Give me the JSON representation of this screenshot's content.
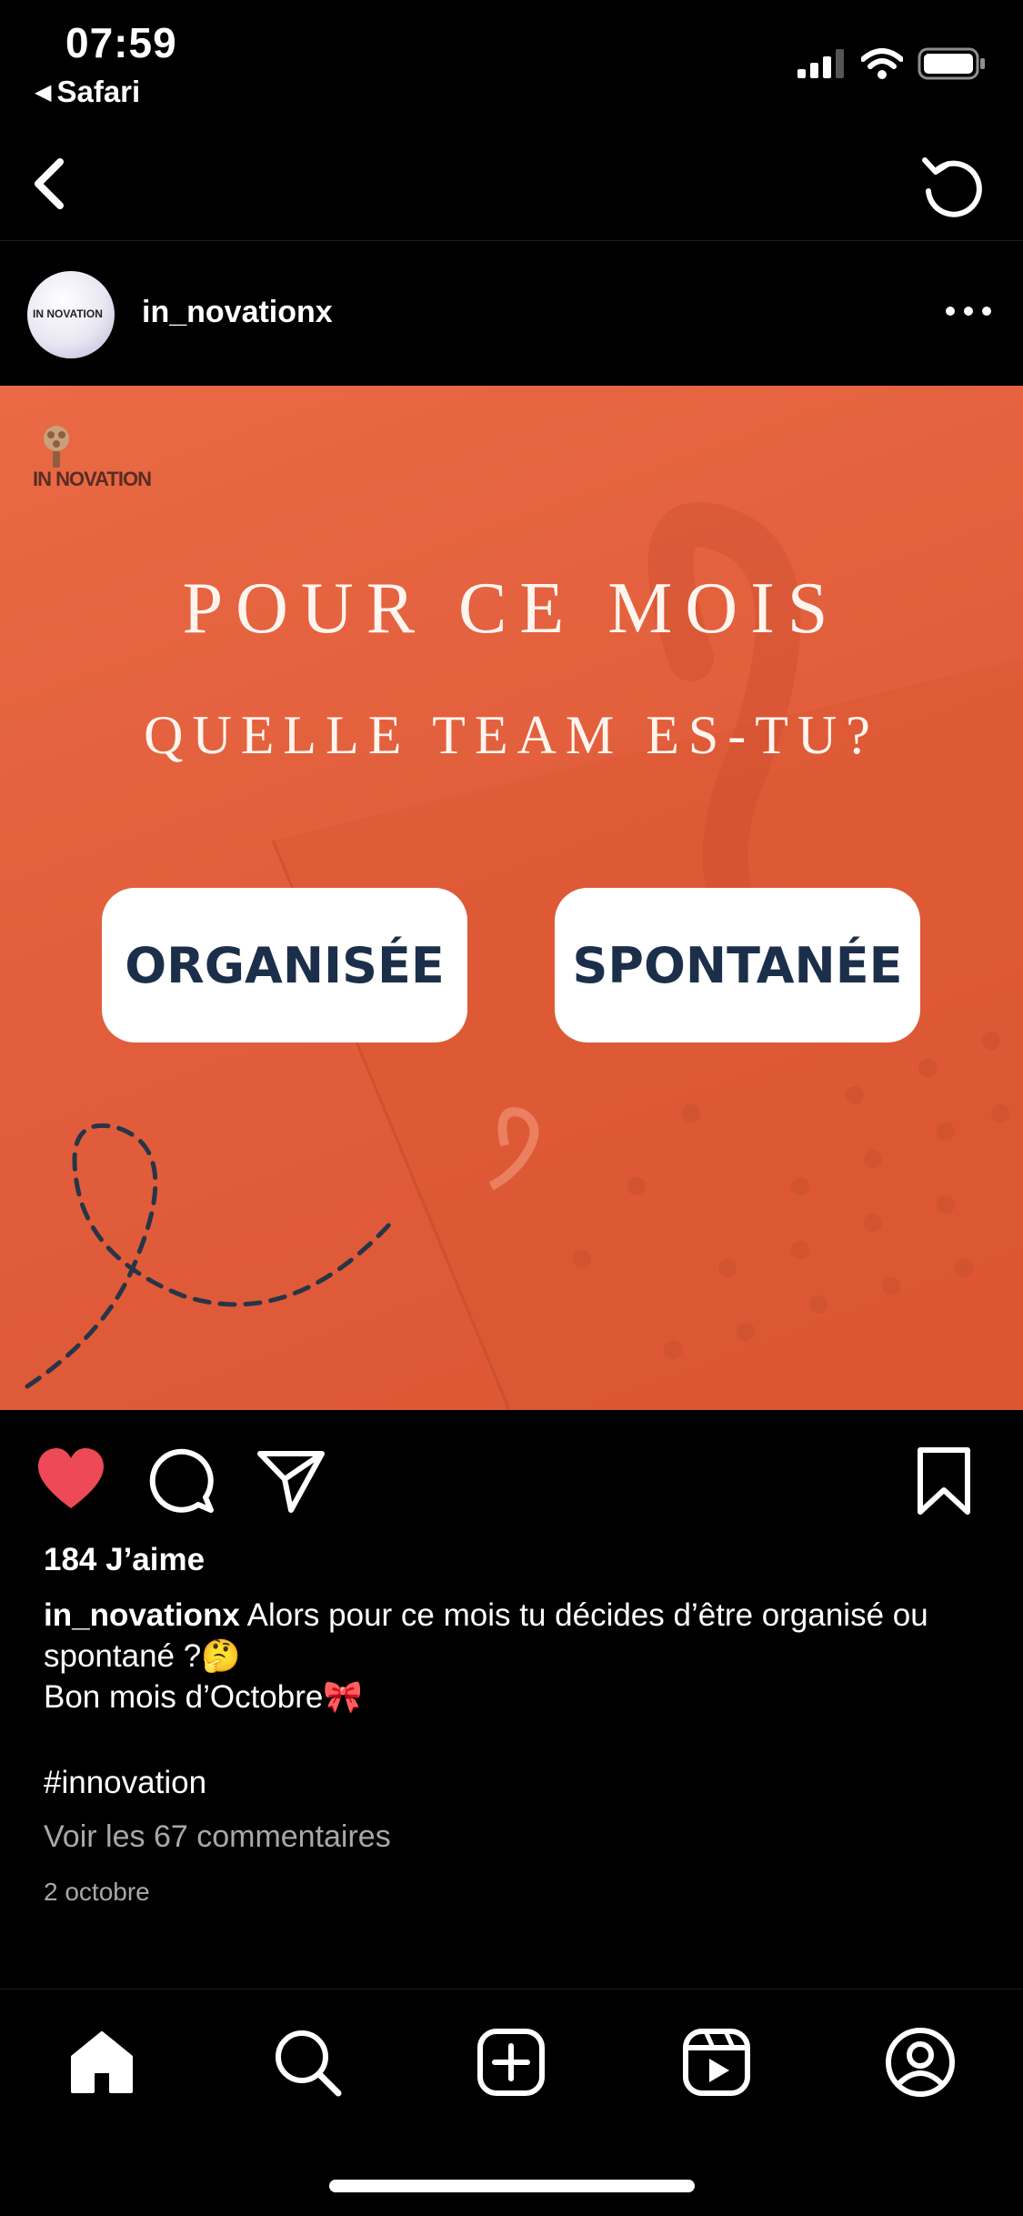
{
  "status_bar": {
    "time": "07:59",
    "back_app": "Safari"
  },
  "post": {
    "username": "in_novationx",
    "avatar_logo_text": "IN NOVATION",
    "image": {
      "brand": "IN NOVATION",
      "headline_line1": "POUR CE MOIS",
      "headline_line2": "QUELLE TEAM ES-TU?",
      "option_left": "ORGANISÉE",
      "option_right": "SPONTANÉE",
      "background_accent": "#e25e3c"
    },
    "liked": true,
    "likes": "184 J’aime",
    "caption_user": "in_novationx",
    "caption_text": "Alors pour ce mois tu décides d’être organisé ou spontané ?🤔",
    "caption_line2": "Bon mois d’Octobre🎀",
    "hashtag": "#innovation",
    "comments_link": "Voir les 67 commentaires",
    "date": "2 octobre"
  },
  "colors": {
    "like_red": "#ed4956",
    "background": "#000000",
    "muted_text": "#a8a8a8",
    "option_text": "#1c2f4a"
  },
  "icons": {
    "nav": [
      "chevron-left-icon",
      "refresh-icon"
    ],
    "actions": [
      "heart-icon",
      "comment-icon",
      "share-icon",
      "bookmark-icon"
    ],
    "tabs": [
      "home-icon",
      "search-icon",
      "new-post-icon",
      "reels-icon",
      "profile-icon"
    ]
  }
}
